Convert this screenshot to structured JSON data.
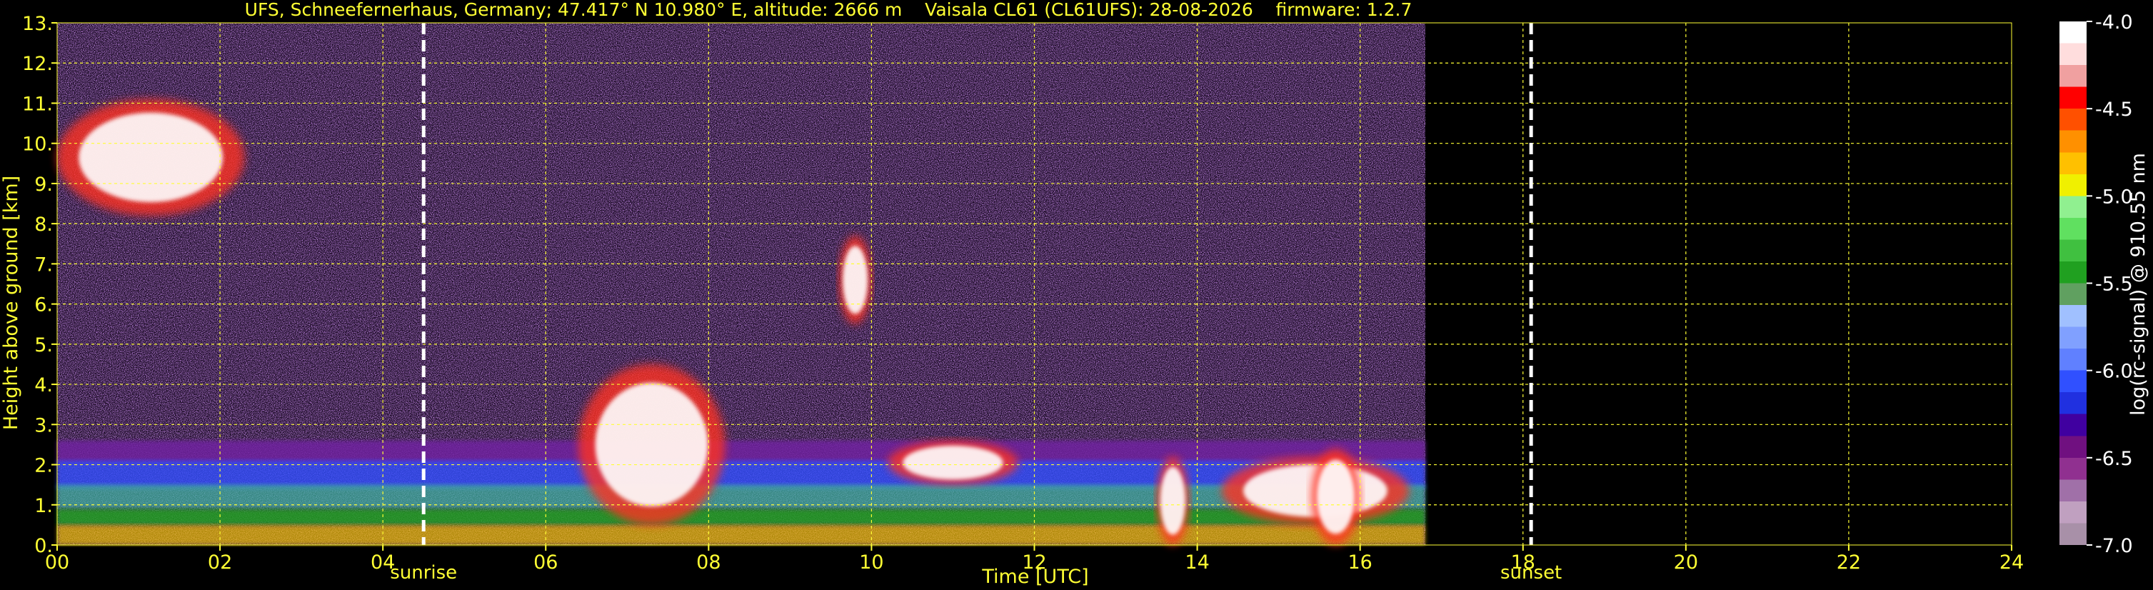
{
  "chart_data": {
    "type": "heatmap",
    "title": "UFS, Schneefernerhaus, Germany; 47.417° N 10.980° E, altitude: 2666 m    Vaisala CL61 (CL61UFS): 28-08-2026    firmware: 1.2.7",
    "xlabel": "Time [UTC]",
    "ylabel": "Height above ground [km]",
    "xlim": [
      0,
      24
    ],
    "ylim": [
      0,
      13
    ],
    "x_ticks": [
      "00",
      "02",
      "04",
      "06",
      "08",
      "10",
      "12",
      "14",
      "16",
      "18",
      "20",
      "22",
      "24"
    ],
    "x_tick_values": [
      0,
      2,
      4,
      6,
      8,
      10,
      12,
      14,
      16,
      18,
      20,
      22,
      24
    ],
    "y_ticks": [
      "0.",
      "1.",
      "2.",
      "3.",
      "4.",
      "5.",
      "6.",
      "7.",
      "8.",
      "9.",
      "10.",
      "11.",
      "12.",
      "13."
    ],
    "y_tick_values": [
      0,
      1,
      2,
      3,
      4,
      5,
      6,
      7,
      8,
      9,
      10,
      11,
      12,
      13
    ],
    "grid": true,
    "data_end_hour": 16.8,
    "markers": [
      {
        "label": "sunrise",
        "hour": 4.5
      },
      {
        "label": "sunset",
        "hour": 18.1
      }
    ],
    "colorbar": {
      "label": "log(rc-signal) @ 910.55 nm",
      "range": [
        -7.0,
        -4.0
      ],
      "ticks": [
        "-4.0",
        "-4.5",
        "-5.0",
        "-5.5",
        "-6.0",
        "-6.5",
        "-7.0"
      ],
      "tick_values": [
        -4.0,
        -4.5,
        -5.0,
        -5.5,
        -6.0,
        -6.5,
        -7.0
      ],
      "colors": [
        "#a890a8",
        "#c0a0c0",
        "#a070a8",
        "#903090",
        "#701080",
        "#4000a0",
        "#2030e0",
        "#3050ff",
        "#6080ff",
        "#80a0ff",
        "#a0c0ff",
        "#60a060",
        "#20a020",
        "#40c040",
        "#60e060",
        "#90f090",
        "#f0f000",
        "#ffc000",
        "#ff9000",
        "#ff5000",
        "#ff0000",
        "#f0a0a0",
        "#ffdddd",
        "#ffffff"
      ]
    },
    "features": [
      {
        "kind": "cloud",
        "t0": 0.0,
        "t1": 2.3,
        "h0": 8.2,
        "h1": 11.1
      },
      {
        "kind": "boundary_layer",
        "t0": 0.0,
        "t1": 16.8,
        "h0": 0.0,
        "h1": 2.6
      },
      {
        "kind": "cloud",
        "t0": 6.4,
        "t1": 8.2,
        "h0": 0.5,
        "h1": 4.5
      },
      {
        "kind": "cloud",
        "t0": 9.6,
        "t1": 10.0,
        "h0": 5.5,
        "h1": 7.7
      },
      {
        "kind": "cloud",
        "t0": 10.2,
        "t1": 11.8,
        "h0": 1.5,
        "h1": 2.6
      },
      {
        "kind": "cloud",
        "t0": 13.5,
        "t1": 13.9,
        "h0": 0.0,
        "h1": 2.2
      },
      {
        "kind": "cloud",
        "t0": 14.3,
        "t1": 16.6,
        "h0": 0.5,
        "h1": 2.2
      },
      {
        "kind": "cloud",
        "t0": 15.4,
        "t1": 16.0,
        "h0": 0.0,
        "h1": 2.4
      }
    ]
  }
}
